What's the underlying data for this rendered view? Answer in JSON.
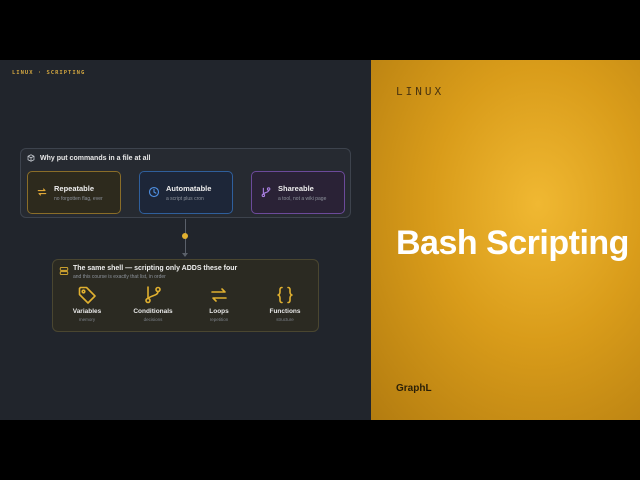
{
  "left": {
    "eyebrow": "LINUX · SCRIPTING",
    "why_card": {
      "title": "Why put commands in a file at all",
      "features": [
        {
          "title": "Repeatable",
          "subtitle": "no forgotten flag, ever",
          "icon": "repeat-icon",
          "color": "#e0a838"
        },
        {
          "title": "Automatable",
          "subtitle": "a script plus cron",
          "icon": "clock-icon",
          "color": "#4e8ee0"
        },
        {
          "title": "Shareable",
          "subtitle": "a tool, not a wiki page",
          "icon": "git-branch-icon",
          "color": "#a87ee0"
        }
      ]
    },
    "shell_card": {
      "title": "The same shell — scripting only ADDS these four",
      "subtitle": "and this course is exactly that list, in order",
      "concepts": [
        {
          "name": "Variables",
          "desc": "memory",
          "icon": "tag-icon"
        },
        {
          "name": "Conditionals",
          "desc": "decisions",
          "icon": "git-branch-icon"
        },
        {
          "name": "Loops",
          "desc": "repetition",
          "icon": "repeat-icon"
        },
        {
          "name": "Functions",
          "desc": "structure",
          "icon": "braces-icon"
        }
      ]
    }
  },
  "right": {
    "eyebrow": "LINUX",
    "title": "Bash Scripting",
    "brand": "GraphL"
  },
  "colors": {
    "accent": "#e0b030",
    "panel_bg": "#21252c",
    "gold": "#e0a82a"
  }
}
